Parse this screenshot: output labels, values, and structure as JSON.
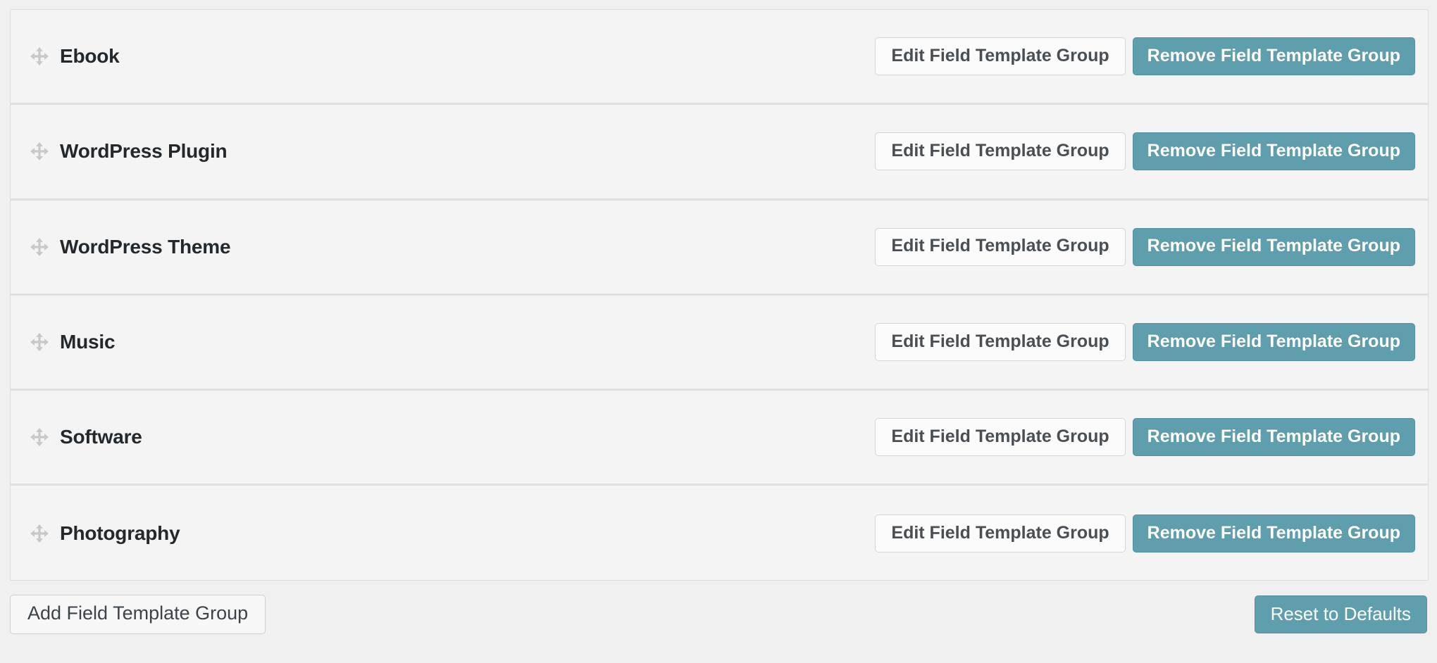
{
  "list": {
    "drag_handle_icon": "move-arrows-icon",
    "groups": [
      {
        "name": "Ebook",
        "edit_label": "Edit Field Template Group",
        "remove_label": "Remove Field Template Group"
      },
      {
        "name": "WordPress Plugin",
        "edit_label": "Edit Field Template Group",
        "remove_label": "Remove Field Template Group"
      },
      {
        "name": "WordPress Theme",
        "edit_label": "Edit Field Template Group",
        "remove_label": "Remove Field Template Group"
      },
      {
        "name": "Music",
        "edit_label": "Edit Field Template Group",
        "remove_label": "Remove Field Template Group"
      },
      {
        "name": "Software",
        "edit_label": "Edit Field Template Group",
        "remove_label": "Remove Field Template Group"
      },
      {
        "name": "Photography",
        "edit_label": "Edit Field Template Group",
        "remove_label": "Remove Field Template Group"
      }
    ]
  },
  "footer": {
    "add_label": "Add Field Template Group",
    "reset_label": "Reset to Defaults"
  },
  "colors": {
    "page_background": "#f0f0f1",
    "row_background": "#f4f4f4",
    "row_separator": "#e0e0e0",
    "container_border": "#dcdcdc",
    "accent_teal": "#5f9ead",
    "accent_teal_border": "#5691a0",
    "label_text": "#23282d",
    "secondary_button_text": "#4a4f54",
    "drag_handle": "#c8c8c8"
  }
}
